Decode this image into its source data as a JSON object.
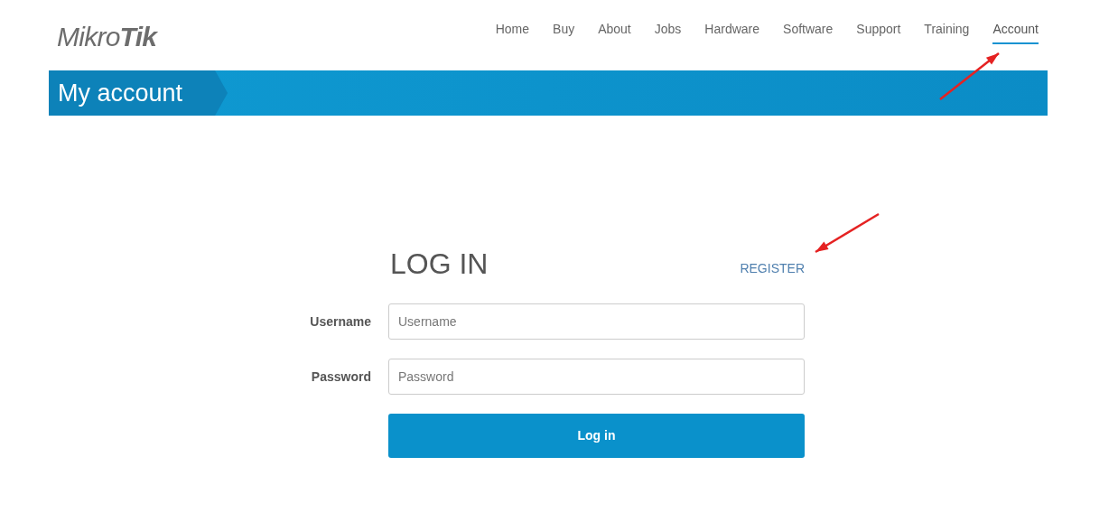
{
  "logo": {
    "text": "Mikro**Tik**"
  },
  "nav": [
    {
      "label": "Home",
      "selected": false
    },
    {
      "label": "Buy",
      "selected": false
    },
    {
      "label": "About",
      "selected": false
    },
    {
      "label": "Jobs",
      "selected": false
    },
    {
      "label": "Hardware",
      "selected": false
    },
    {
      "label": "Software",
      "selected": false
    },
    {
      "label": "Support",
      "selected": false
    },
    {
      "label": "Training",
      "selected": false
    },
    {
      "label": "Account",
      "selected": true
    }
  ],
  "banner": {
    "title": "My account"
  },
  "login": {
    "title": "LOG IN",
    "register_link": "REGISTER",
    "fields": [
      {
        "label": "Username",
        "placeholder": "Username"
      },
      {
        "label": "Password",
        "placeholder": "Password"
      }
    ],
    "button": "Log in"
  }
}
